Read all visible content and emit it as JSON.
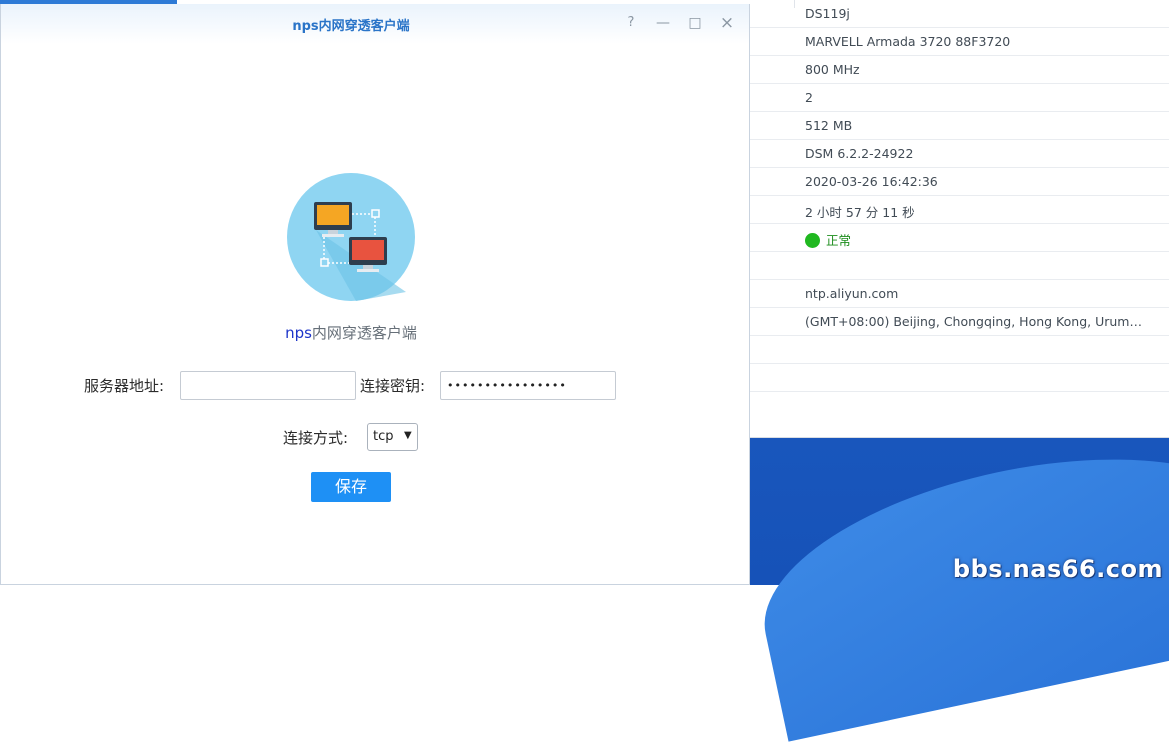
{
  "window": {
    "title": "nps内网穿透客户端",
    "buttons": {
      "help": "?",
      "minimize": "—",
      "maximize": "□",
      "close": "×"
    }
  },
  "app": {
    "name_prefix": "nps",
    "name_suffix": "内网穿透客户端"
  },
  "form": {
    "server_label": "服务器地址:",
    "server_value": "",
    "key_label": "连接密钥:",
    "key_value": "••••••••••••••••",
    "mode_label": "连接方式:",
    "mode_value": "tcp",
    "save_label": "保存"
  },
  "info_panel": {
    "rows": [
      "DS119j",
      "MARVELL Armada 3720 88F3720",
      "800 MHz",
      "2",
      "512 MB",
      "DSM 6.2.2-24922",
      "2020-03-26 16:42:36",
      "2 小时 57 分 11 秒",
      "正常",
      "",
      "ntp.aliyun.com",
      "(GMT+08:00) Beijing, Chongqing, Hong Kong, Urum…",
      "",
      ""
    ],
    "status_color": "#20b820"
  },
  "watermark": "bbs.nas66.com",
  "colors": {
    "accent": "#1e90f5",
    "title": "#2a74c8",
    "nps": "#1d35c9"
  }
}
